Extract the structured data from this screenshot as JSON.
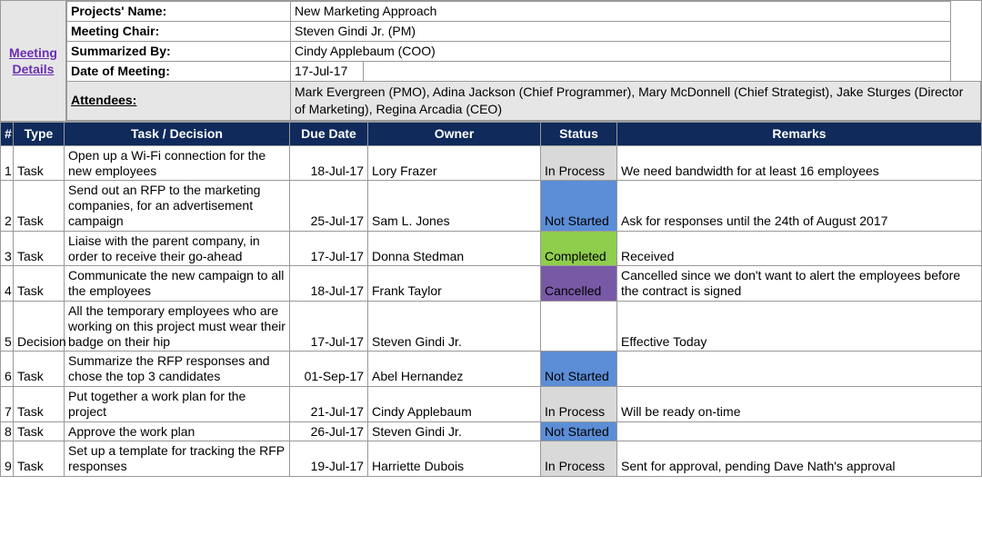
{
  "header": {
    "meeting_details_label": "Meeting Details",
    "rows": [
      {
        "label": "Projects' Name:",
        "value": "New Marketing Approach"
      },
      {
        "label": "Meeting Chair:",
        "value": "Steven Gindi Jr. (PM)"
      },
      {
        "label": "Summarized By:",
        "value": "Cindy Applebaum (COO)"
      },
      {
        "label": "Date of Meeting:",
        "value": "17-Jul-17"
      }
    ],
    "attendees_label": "Attendees:",
    "attendees": "Mark Evergreen (PMO), Adina Jackson (Chief Programmer), Mary McDonnell (Chief Strategist), Jake Sturges (Director of Marketing), Regina Arcadia (CEO)"
  },
  "columns": {
    "num": "#",
    "type": "Type",
    "task": "Task / Decision",
    "due": "Due Date",
    "owner": "Owner",
    "status": "Status",
    "remarks": "Remarks"
  },
  "rows": [
    {
      "num": "1",
      "type": "Task",
      "task": "Open up a Wi-Fi connection for the new employees",
      "due": "18-Jul-17",
      "owner": "Lory Frazer",
      "status": "In Process",
      "status_class": "status-inprocess",
      "remarks": "We need bandwidth for at least 16 employees"
    },
    {
      "num": "2",
      "type": "Task",
      "task": "Send out an RFP to the marketing companies, for an advertisement campaign",
      "due": "25-Jul-17",
      "owner": "Sam L. Jones",
      "status": "Not Started",
      "status_class": "status-notstarted",
      "remarks": "Ask for responses until the 24th of August 2017"
    },
    {
      "num": "3",
      "type": "Task",
      "task": "Liaise with the parent company, in order to receive their go-ahead",
      "due": "17-Jul-17",
      "owner": "Donna Stedman",
      "status": "Completed",
      "status_class": "status-completed",
      "remarks": "Received"
    },
    {
      "num": "4",
      "type": "Task",
      "task": "Communicate the new campaign to all the employees",
      "due": "18-Jul-17",
      "owner": "Frank Taylor",
      "status": "Cancelled",
      "status_class": "status-cancelled",
      "remarks": "Cancelled since we don't want to alert the employees before the contract is signed"
    },
    {
      "num": "5",
      "type": "Decision",
      "task": "All the temporary employees who are working on this project must wear their badge on their hip",
      "due": "17-Jul-17",
      "owner": "Steven Gindi Jr.",
      "status": "",
      "status_class": "",
      "remarks": "Effective Today"
    },
    {
      "num": "6",
      "type": "Task",
      "task": "Summarize the RFP responses and chose the top 3 candidates",
      "due": "01-Sep-17",
      "owner": "Abel Hernandez",
      "status": "Not Started",
      "status_class": "status-notstarted",
      "remarks": ""
    },
    {
      "num": "7",
      "type": "Task",
      "task": "Put together a work plan for the project",
      "due": "21-Jul-17",
      "owner": "Cindy Applebaum",
      "status": "In Process",
      "status_class": "status-inprocess",
      "remarks": "Will be ready on-time"
    },
    {
      "num": "8",
      "type": "Task",
      "task": "Approve the work plan",
      "due": "26-Jul-17",
      "owner": "Steven Gindi Jr.",
      "status": "Not Started",
      "status_class": "status-notstarted",
      "remarks": ""
    },
    {
      "num": "9",
      "type": "Task",
      "task": "Set up a template for tracking the RFP responses",
      "due": "19-Jul-17",
      "owner": "Harriette Dubois",
      "status": "In Process",
      "status_class": "status-inprocess",
      "remarks": "Sent for approval, pending Dave Nath's approval"
    }
  ]
}
